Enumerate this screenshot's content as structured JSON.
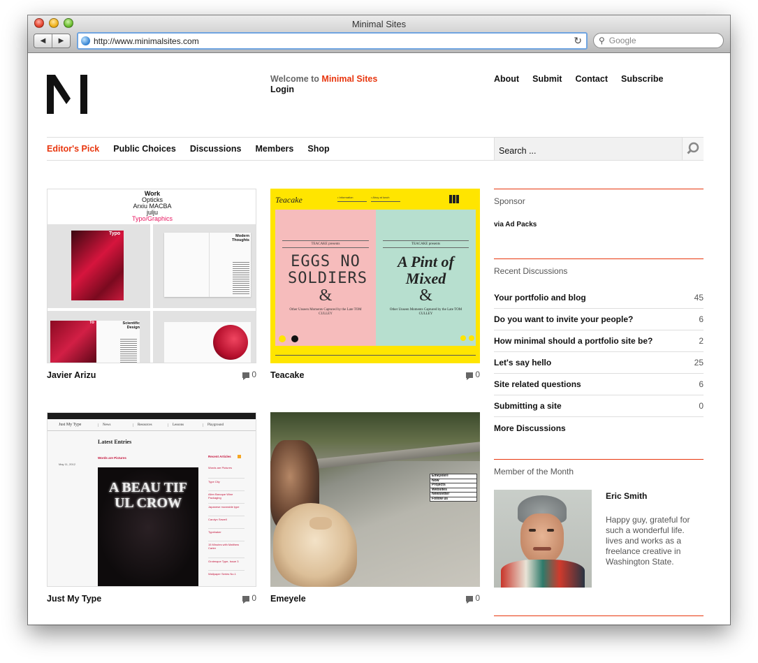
{
  "window": {
    "title": "Minimal Sites",
    "back_label": "◀",
    "forward_label": "▶",
    "url": "http://www.minimalsites.com",
    "search_placeholder": "Google",
    "reload_icon": "reload-icon"
  },
  "header": {
    "welcome_prefix": "Welcome to ",
    "site_name": "Minimal Sites",
    "login_label": "Login",
    "links": [
      "About",
      "Submit",
      "Contact",
      "Subscribe"
    ]
  },
  "menu": {
    "items": [
      "Editor's Pick",
      "Public Choices",
      "Discussions",
      "Members",
      "Shop"
    ],
    "active": "Editor's Pick",
    "search_placeholder": "Search ..."
  },
  "cards": [
    {
      "name": "Javier Arizu",
      "comments": "0",
      "thumb": {
        "lines": [
          "Work",
          "Opticks",
          "Arxiu MACBA",
          "julju"
        ],
        "accent_line": "Typo/Graphics",
        "panel_labels": [
          "Typo",
          "Modern Thoughts",
          "To",
          "Scientific Design"
        ]
      }
    },
    {
      "name": "Teacake",
      "comments": "0",
      "thumb": {
        "brand": "Teacake",
        "presents": "TEACAKE presents",
        "left_title": "EGGS NO SOLDIERS",
        "right_title": "A Pint of Mixed",
        "amp": "&",
        "subtitle": "Other Unseen Moments Captured by the Late TOM CULLEY",
        "dropdown_1": "• Information",
        "dropdown_2": "• Ahoy at lunch"
      }
    },
    {
      "name": "Just My Type",
      "comments": "0",
      "thumb": {
        "brand": "Just My Type",
        "nav": [
          "News",
          "Resources",
          "Lessons",
          "Playground"
        ],
        "heading": "Latest Entries",
        "post_title": "Words are Pictures",
        "date": "May 11, 2012",
        "poster_text": "A BEAU TIF UL CROW",
        "sidebar_title": "Recent Articles",
        "articles": [
          "Words are Pictures",
          "Type City",
          "Allen Baroque Wine Packaging",
          "Japanese moveable type",
          "Carolyn Sewell",
          "Typebaker",
          "15 Minutes with Matthew Carter",
          "Grotesque Type, Issue 3",
          "Wallpaper Series No.1"
        ]
      }
    },
    {
      "name": "Emeyele",
      "comments": "0",
      "thumb": {
        "menu": [
          "Emeyele®",
          "Now",
          "Projects",
          "Websites",
          "Newsletter",
          "Follow us"
        ]
      }
    }
  ],
  "sidebar": {
    "sponsor": {
      "title": "Sponsor",
      "sub": "via Ad Packs"
    },
    "discussions": {
      "title": "Recent Discussions",
      "items": [
        {
          "title": "Your portfolio and blog",
          "count": "45"
        },
        {
          "title": "Do you want to invite your people?",
          "count": "6"
        },
        {
          "title": "How minimal should a portfolio site be?",
          "count": "2"
        },
        {
          "title": "Let's say hello",
          "count": "25"
        },
        {
          "title": "Site related questions",
          "count": "6"
        },
        {
          "title": "Submitting a site",
          "count": "0"
        }
      ],
      "more_label": "More Discussions"
    },
    "member": {
      "title": "Member of the Month",
      "name": "Eric Smith",
      "bio": "Happy guy, grateful for such a wonderful life. lives and works as a freelance creative in Washington State."
    }
  },
  "colors": {
    "accent": "#e8360e",
    "text": "#111111",
    "muted": "#555555"
  }
}
